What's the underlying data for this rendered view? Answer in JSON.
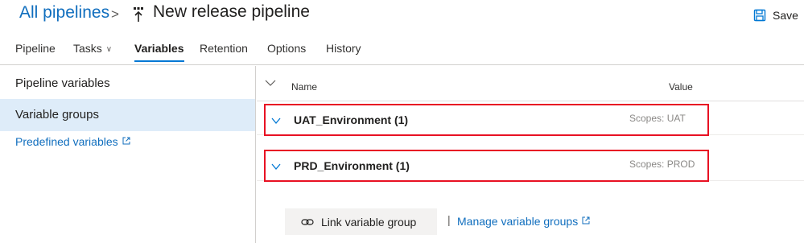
{
  "header": {
    "breadcrumb_parent": "All pipelines",
    "breadcrumb_separator": ">",
    "title": "New release pipeline",
    "save_label": "Save"
  },
  "tabs": [
    {
      "label": "Pipeline"
    },
    {
      "label": "Tasks",
      "has_dropdown": true
    },
    {
      "label": "Variables",
      "selected": true
    },
    {
      "label": "Retention"
    },
    {
      "label": "Options"
    },
    {
      "label": "History"
    }
  ],
  "sidebar": {
    "items": [
      {
        "label": "Pipeline variables"
      },
      {
        "label": "Variable groups",
        "active": true
      }
    ],
    "link": "Predefined variables"
  },
  "table": {
    "col_name": "Name",
    "col_value": "Value",
    "groups": [
      {
        "name": "UAT_Environment (1)",
        "scope": "Scopes: UAT"
      },
      {
        "name": "PRD_Environment (1)",
        "scope": "Scopes: PROD"
      }
    ]
  },
  "actions": {
    "link_group_label": "Link variable group",
    "divider": "|",
    "manage_groups_label": "Manage variable groups"
  },
  "colors": {
    "accent": "#0078d4",
    "link": "#106ebe",
    "highlight_border": "#e81123",
    "selected_bg": "#deecf9"
  },
  "icons": {
    "pipeline": "release-pipeline-icon",
    "save": "save-icon",
    "external": "external-link-icon",
    "chain": "link-chain-icon",
    "chevron": "chevron-down-icon"
  }
}
